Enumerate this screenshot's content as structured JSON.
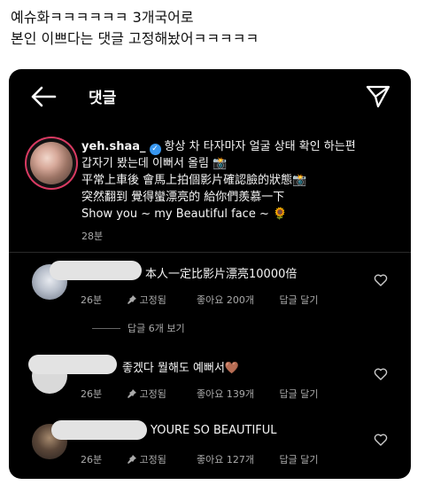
{
  "post": {
    "line1": "예슈화ㅋㅋㅋㅋㅋㅋ 3개국어로",
    "line2": "본인 이쁘다는 댓글 고정해놨어ㅋㅋㅋㅋㅋ"
  },
  "topbar": {
    "title": "댓글",
    "back_icon": "arrow-left-icon",
    "send_icon": "paper-plane-icon"
  },
  "main_comment": {
    "username": "yeh.shaa_",
    "verified_icon": "verified-badge-icon",
    "lines": [
      "항상 차 타자마자 얼굴 상태 확인 하는편",
      "갑자기 봤는데 이뻐서 올림 📸",
      "平常上車後 會馬上拍個影片確認臉的狀態📸",
      "突然翻到 覺得蠻漂亮的 給你們羨慕一下",
      "Show you ~ my Beautiful face ~ 🌻"
    ],
    "time": "28분"
  },
  "replies": [
    {
      "avatar_icon": "cat-avatar-icon",
      "text": "本人一定比影片漂亮10000倍",
      "time": "26분",
      "pinned": "고정됨",
      "likes": "좋아요 200개",
      "reply_label": "답글 달기"
    },
    {
      "avatar_icon": "default-avatar-icon",
      "text": "좋겠다 뭘해도 예뻐서🤎",
      "time": "26분",
      "pinned": "고정됨",
      "likes": "좋아요 139개",
      "reply_label": "답글 달기"
    },
    {
      "avatar_icon": "dog-avatar-icon",
      "text": "YOURE SO BEAUTIFUL",
      "time": "26분",
      "pinned": "고정됨",
      "likes": "좋아요 127개",
      "reply_label": "답글 달기"
    }
  ],
  "view_replies": "답글 6개 보기",
  "colors": {
    "background": "#000000",
    "text": "#f5f5f5",
    "muted": "#aaaaaa",
    "verified": "#3897f0",
    "story_ring": "#d93a62"
  }
}
